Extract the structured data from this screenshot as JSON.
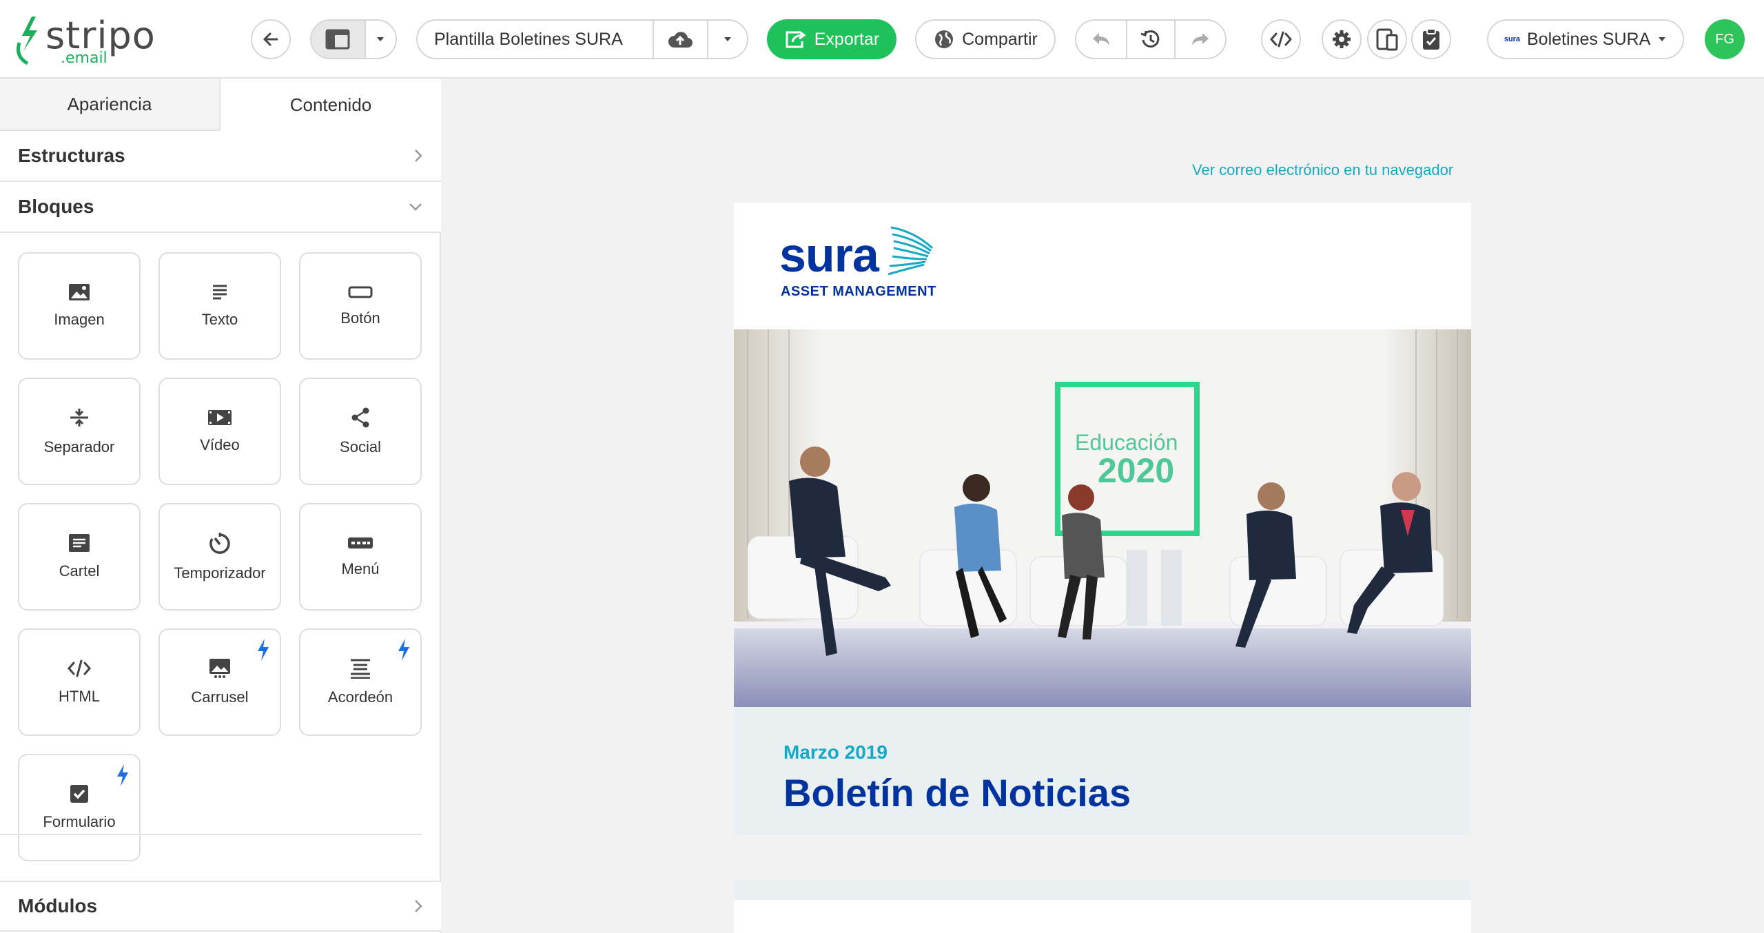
{
  "app": {
    "logo_text": "stripo",
    "logo_sub": ".email"
  },
  "toolbar": {
    "template_name": "Plantilla Boletines SURA",
    "export_label": "Exportar",
    "share_label": "Compartir",
    "account_label": "Boletines SURA",
    "account_mini_logo": "sura",
    "avatar_initials": "FG",
    "accent_color": "#1fc25a"
  },
  "sidebar": {
    "tabs": [
      {
        "label": "Apariencia",
        "active": false
      },
      {
        "label": "Contenido",
        "active": true
      }
    ],
    "sections": {
      "structures": "Estructuras",
      "blocks": "Bloques",
      "modules": "Módulos"
    },
    "blocks": [
      {
        "label": "Imagen",
        "icon": "image-icon",
        "amp": false
      },
      {
        "label": "Texto",
        "icon": "text-icon",
        "amp": false
      },
      {
        "label": "Botón",
        "icon": "button-icon",
        "amp": false
      },
      {
        "label": "Separador",
        "icon": "separator-icon",
        "amp": false
      },
      {
        "label": "Vídeo",
        "icon": "video-icon",
        "amp": false
      },
      {
        "label": "Social",
        "icon": "share-icon",
        "amp": false
      },
      {
        "label": "Cartel",
        "icon": "banner-icon",
        "amp": false
      },
      {
        "label": "Temporizador",
        "icon": "timer-icon",
        "amp": false
      },
      {
        "label": "Menú",
        "icon": "menu-icon",
        "amp": false
      },
      {
        "label": "HTML",
        "icon": "code-icon",
        "amp": false
      },
      {
        "label": "Carrusel",
        "icon": "carousel-icon",
        "amp": true
      },
      {
        "label": "Acordeón",
        "icon": "accordion-icon",
        "amp": true
      },
      {
        "label": "Formulario",
        "icon": "form-icon",
        "amp": true
      }
    ]
  },
  "canvas": {
    "view_in_browser": "Ver correo electrónico en tu navegador",
    "email": {
      "brand": "sura",
      "brand_sub": "ASSET MANAGEMENT",
      "hero_screen_text_1": "Educación",
      "hero_screen_text_2": "2020",
      "issue_date": "Marzo 2019",
      "newsletter_title": "Boletín de Noticias",
      "brand_color": "#0033a0",
      "accent_color": "#16a9c4"
    }
  }
}
